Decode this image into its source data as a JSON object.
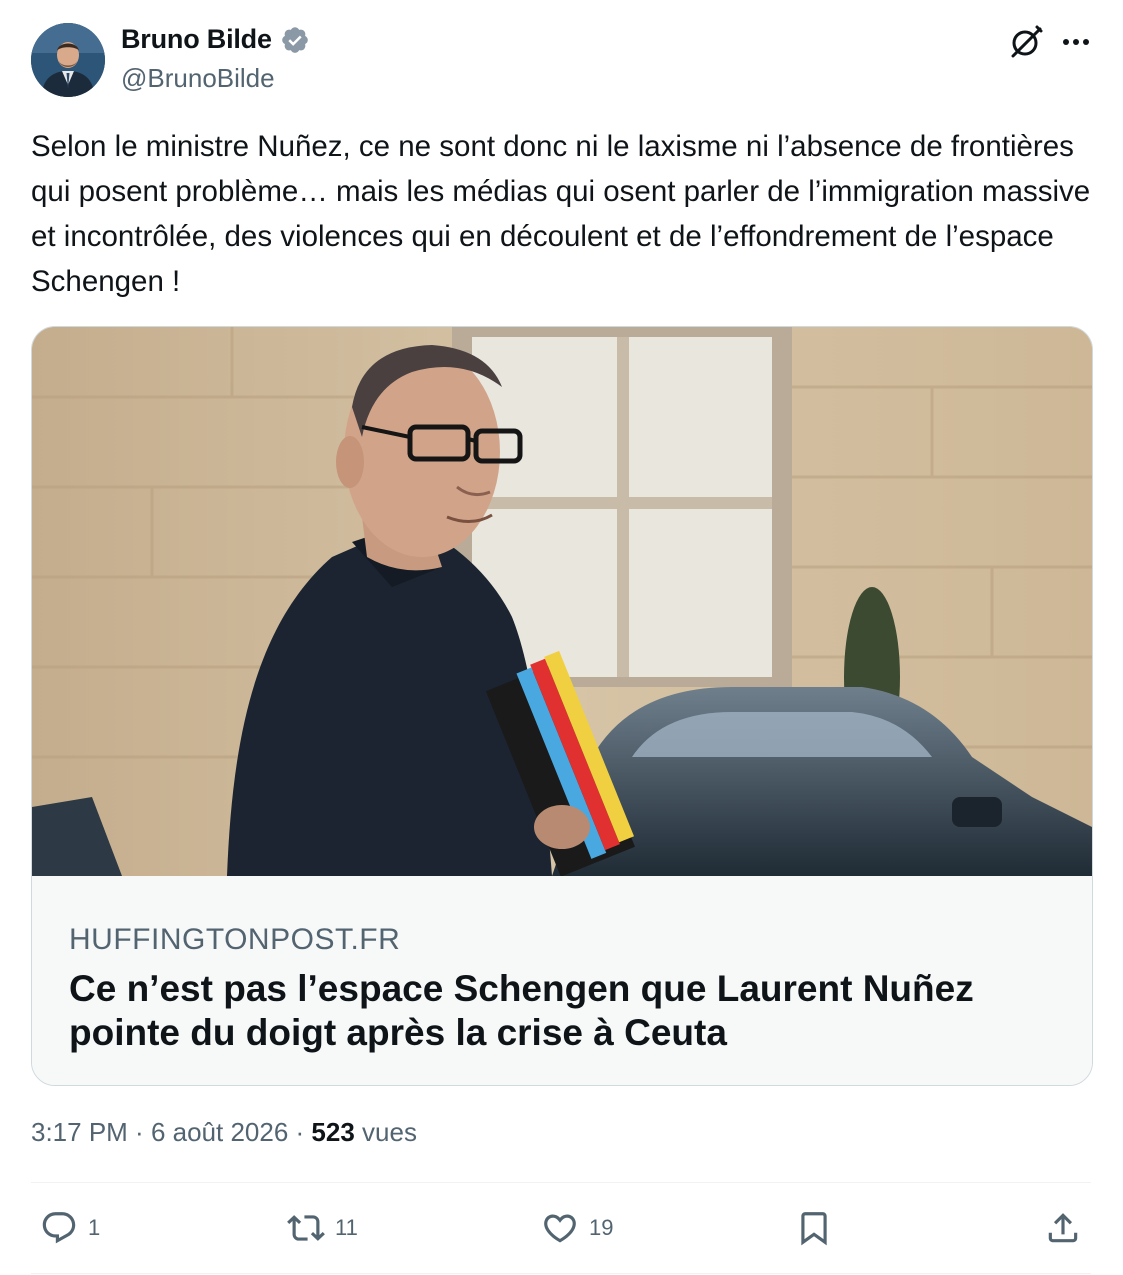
{
  "author": {
    "name": "Bruno Bilde",
    "handle": "@BrunoBilde",
    "verified": true,
    "avatar_icon": "profile-photo"
  },
  "header_actions": {
    "grok_icon": "grok-icon",
    "more_icon": "more-dots-icon"
  },
  "tweet": {
    "text": "Selon le ministre Nuñez, ce ne sont donc ni le laxisme ni l’absence de frontières qui posent problème… mais les médias qui osent parler de l’immigration massive et incontrôlée, des violences qui en découlent et de l’effondrement de l’espace Schengen !"
  },
  "link_card": {
    "domain": "HUFFINGTONPOST.FR",
    "title": "Ce n’est pas l’espace Schengen que Laurent Nuñez pointe du doigt après la crise à Ceuta"
  },
  "meta": {
    "time": "3:17 PM",
    "dot1": " · ",
    "date": "6 août 2026",
    "dot2": " · ",
    "views_count": "523",
    "views_label": " vues"
  },
  "actions": {
    "replies": "1",
    "retweets": "11",
    "likes": "19"
  },
  "colors": {
    "text_primary": "#0f1419",
    "text_secondary": "#536471",
    "verified_blue": "#1d9bf0",
    "border": "#cfd9de"
  }
}
